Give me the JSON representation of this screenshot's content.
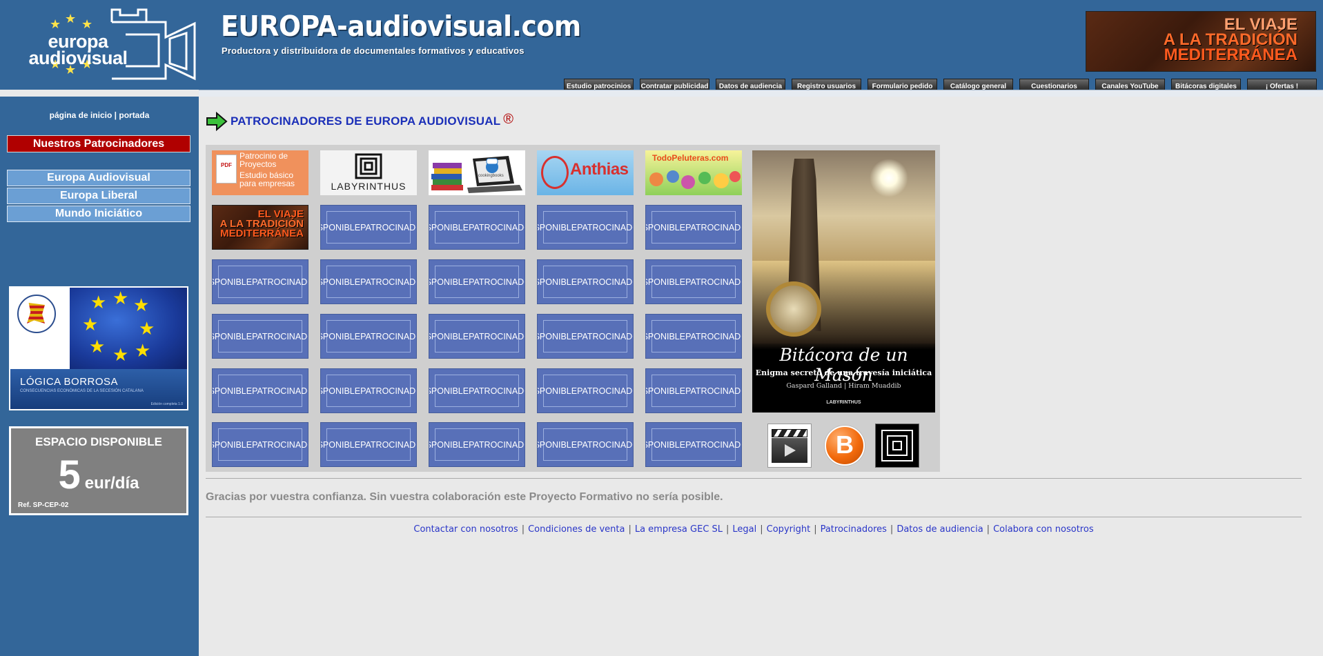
{
  "header": {
    "logo_line1": "europa",
    "logo_line2": "audiovisual",
    "site_title": "EUROPA-audiovisual.com",
    "site_subtitle": "Productora y distribuidora de documentales formativos y educativos",
    "banner": {
      "line1": "EL VIAJE",
      "line2": "A LA TRADICIÓN",
      "line3": "MEDITERRÁNEA"
    }
  },
  "topnav": [
    "Estudio patrocinios",
    "Contratar publicidad",
    "Datos de audiencia",
    "Registro usuarios",
    "Formulario pedido",
    "Catálogo general",
    "Cuestionarios",
    "Canales YouTube",
    "Bitácoras digitales",
    "¡ Ofertas !"
  ],
  "sidebar": {
    "home_link": "página de inicio",
    "sep": "|",
    "portada_link": "portada",
    "patrocinadores_button": "Nuestros Patrocinadores",
    "links": [
      "Europa Audiovisual",
      "Europa Liberal",
      "Mundo Iniciático"
    ],
    "logica_banner": {
      "title": "LÓGICA BORROSA",
      "subtitle": "CONSECUENCIAS ECONÓMICAS DE LA SECESIÓN CATALANA",
      "edition": "Edición completa 1.0"
    },
    "espacio_banner": {
      "heading": "ESPACIO DISPONIBLE",
      "price": "5",
      "unit": "eur/día",
      "ref": "Ref. SP-CEP-02"
    }
  },
  "main": {
    "heading": "PATROCINADORES DE EUROPA AUDIOVISUAL",
    "registered_mark": "®",
    "sponsors_row1": {
      "patrocinio": {
        "line1": "Patrocinio de",
        "line2": "Proyectos",
        "line3": "Estudio básico",
        "line4": "para empresas"
      },
      "labyrinthus": "LABYRINTHUS",
      "books_label": "cookingbooks",
      "anthias": "Anthias",
      "todopeluteras": "TodoPeluteras.com"
    },
    "viaje_tile": {
      "line1": "EL VIAJE",
      "line2": "A LA TRADICIÓN",
      "line3": "MEDITERRÁNEA"
    },
    "disponible": {
      "line1": "DISPONIBLE",
      "line2": "PATROCINADOR"
    },
    "bitacora": {
      "title": "Bitácora de un Masón",
      "subtitle": "Enigma secreto de una travesía iniciática",
      "authors": "Gaspard Galland  |  Hiram Muaddib",
      "publisher": "LABYRINTHUS"
    },
    "thanks": "Gracias por vuestra confianza. Sin vuestra colaboración este Proyecto Formativo no sería posible."
  },
  "footer": {
    "links": [
      "Contactar con nosotros",
      "Condiciones de venta",
      "La empresa GEC SL",
      "Legal",
      "Copyright",
      "Patrocinadores",
      "Datos de audiencia",
      "Colabora con nosotros"
    ],
    "separator": "|"
  }
}
